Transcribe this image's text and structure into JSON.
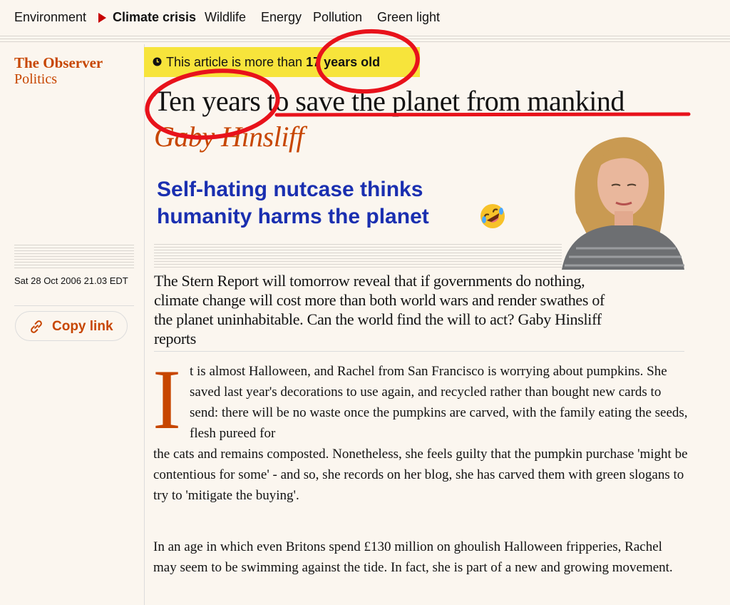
{
  "nav": {
    "items": [
      "Environment",
      "Climate crisis",
      "Wildlife",
      "Energy",
      "Pollution",
      "Green light"
    ],
    "active_index": 1
  },
  "brand": {
    "name": "The Observer",
    "section": "Politics"
  },
  "meta": {
    "date": "Sat 28 Oct 2006 21.03 EDT",
    "copy_link_label": "Copy link"
  },
  "age_banner": {
    "prefix": "This article is more than ",
    "emphasis": "17 years old"
  },
  "article": {
    "headline": "Ten years to save the planet from mankind",
    "byline": "Gaby Hinsliff",
    "standfirst": "The Stern Report will tomorrow reveal that if governments do nothing, climate change will cost more than both world wars and render swathes of the planet uninhabitable. Can the world find the will to act? Gaby Hinsliff reports",
    "dropcap": "I",
    "para1_start": "t is almost Halloween, and Rachel from San Francisco is worrying about pumpkins. She saved last year's decorations to use again, and recycled rather than bought new cards to send: there will be no waste once the pumpkins are carved, with the family eating the seeds, flesh pureed for",
    "para1_rest": "the cats and remains composted. Nonetheless, she feels guilty that the pumpkin purchase 'might be contentious for some' - and so, she records on her blog, she has carved them with green slogans to try to 'mitigate the buying'.",
    "para2": "In an age in which even Britons spend £130 million on ghoulish Halloween fripperies, Rachel may seem to be swimming against the tide. In fact, she is part of a new and growing movement."
  },
  "overlay": {
    "line1": "Self-hating nutcase thinks",
    "line2": "humanity harms the planet",
    "emoji_icon": "rolling-on-floor-laughing-emoji"
  },
  "colors": {
    "background": "#fbf6ef",
    "brand_orange": "#c74600",
    "banner_yellow": "#f7e43b",
    "overlay_blue": "#1a2fb0",
    "annotation_red": "#e8121b"
  }
}
